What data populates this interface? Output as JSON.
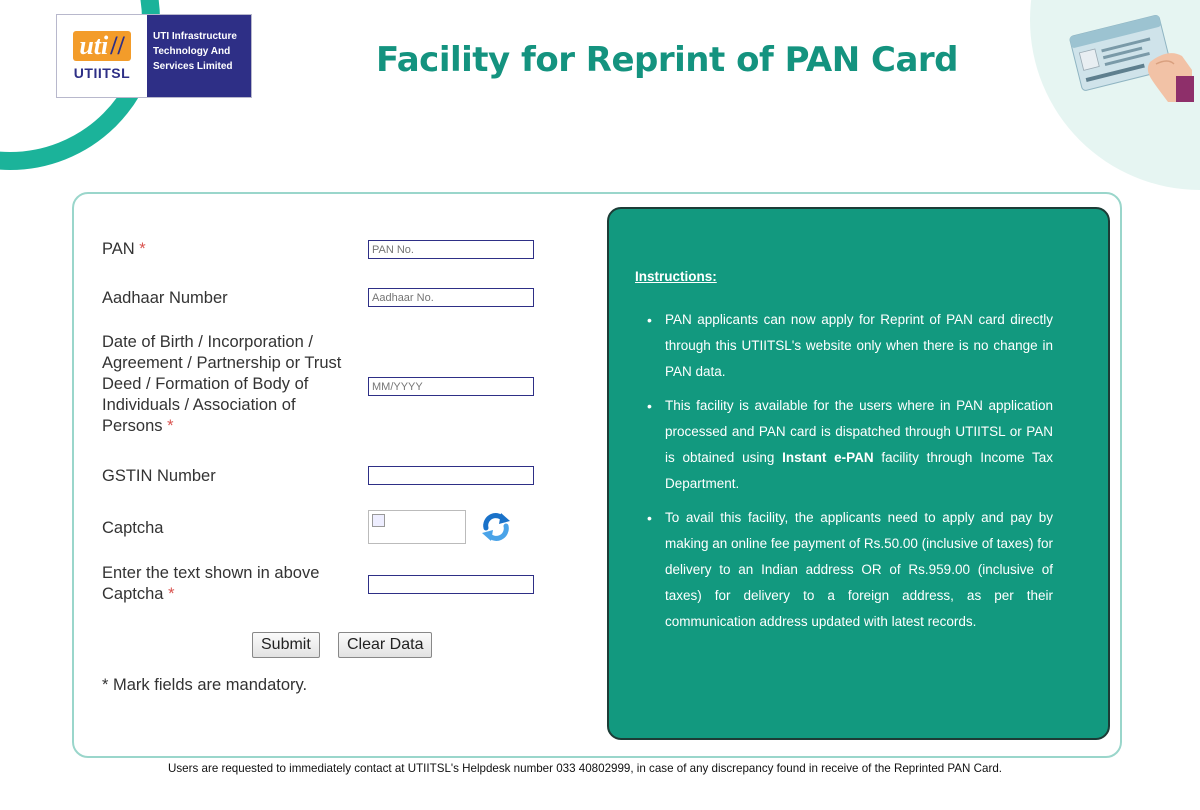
{
  "logo": {
    "mark": "uti",
    "sub": "UTIITSL",
    "org_line1": "UTI Infrastructure",
    "org_line2": "Technology And",
    "org_line3": "Services Limited"
  },
  "page_title": "Facility for Reprint of PAN Card",
  "form": {
    "pan_label": "PAN",
    "pan_placeholder": "PAN No.",
    "aadhaar_label": "Aadhaar Number",
    "aadhaar_placeholder": "Aadhaar No.",
    "dob_label_line1": "Date of Birth / Incorporation /",
    "dob_label_line2": "Agreement / Partnership or Trust",
    "dob_label_line3": "Deed / Formation of Body of",
    "dob_label_line4": "Individuals / Association of",
    "dob_label_line5": "Persons",
    "dob_placeholder": "MM/YYYY",
    "gstin_label": "GSTIN Number",
    "captcha_label": "Captcha",
    "captcha_text_label_line1": "Enter the text shown in above",
    "captcha_text_label_line2": "Captcha",
    "required_mark": "*",
    "submit_label": "Submit",
    "clear_label": "Clear Data",
    "mandatory_note": "* Mark fields are mandatory."
  },
  "instructions": {
    "heading": "Instructions:",
    "item1": "PAN applicants can now apply for Reprint of PAN card directly through this UTIITSL's website only when there is no change in PAN data.",
    "item2_part1": "This facility is available for the users where in PAN application processed and PAN card is dispatched through UTIITSL or PAN is obtained using ",
    "item2_bold": "Instant e-PAN",
    "item2_part2": " facility through Income Tax Department.",
    "item3": "To avail this facility, the applicants need to apply and pay by making an online fee payment of Rs.50.00 (inclusive of taxes) for delivery to an Indian address OR of Rs.959.00 (inclusive of taxes) for delivery to a foreign address, as per their communication address updated with latest records."
  },
  "footer_note": "Users are requested to immediately contact at UTIITSL's Helpdesk number 033 40802999, in case of any discrepancy found in receive of the Reprinted PAN Card.",
  "colors": {
    "brand_teal": "#14937f",
    "panel_teal": "#12997f",
    "brand_navy": "#2e2f86",
    "brand_orange": "#f39c2a",
    "required_red": "#d9534f"
  },
  "icons": {
    "refresh": "refresh-icon",
    "broken_image": "broken-image-icon",
    "hand_card": "hand-holding-card-icon"
  }
}
